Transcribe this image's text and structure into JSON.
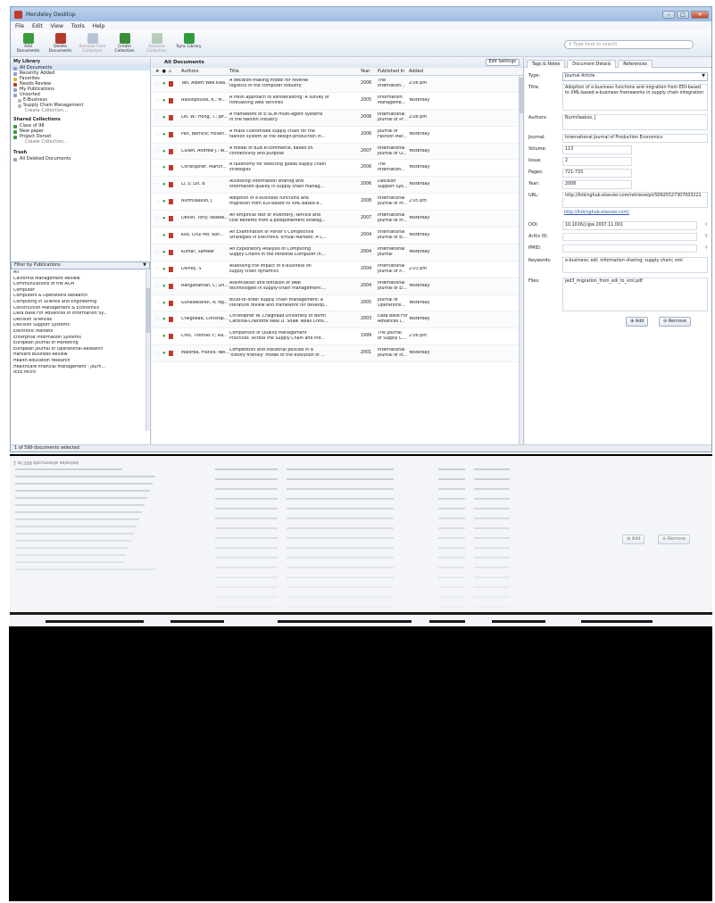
{
  "window": {
    "title": "Mendeley Desktop",
    "controls": [
      "–",
      "□",
      "✕"
    ]
  },
  "menu": [
    "File",
    "Edit",
    "View",
    "Tools",
    "Help"
  ],
  "toolbar": {
    "buttons": [
      {
        "label": "Add Documents",
        "icon": "add-document-icon",
        "enabled": true,
        "color": "#3a9b3a"
      },
      {
        "label": "Delete Documents",
        "icon": "delete-document-icon",
        "enabled": true,
        "color": "#b43b2b"
      },
      {
        "label": "Remove from Collection",
        "icon": "remove-from-collection-icon",
        "enabled": false,
        "color": "#6d86a8"
      },
      {
        "label": "Create Collection",
        "icon": "create-collection-icon",
        "enabled": true,
        "color": "#3a8e3a"
      },
      {
        "label": "Remove Collection",
        "icon": "remove-collection-icon",
        "enabled": false,
        "color": "#6d9a6d"
      },
      {
        "label": "Sync Library",
        "icon": "sync-icon",
        "enabled": true,
        "color": "#2e9d3d"
      }
    ],
    "search_placeholder": "Type here to search"
  },
  "sidebar": {
    "my_library_heading": "My Library",
    "library_items": [
      {
        "label": "All Documents",
        "selected": true,
        "color": "#8aa3c4"
      },
      {
        "label": "Recently Added",
        "selected": false,
        "color": "#8aa3c4"
      },
      {
        "label": "Favorites",
        "selected": false,
        "color": "#e2b23a"
      },
      {
        "label": "Needs Review",
        "selected": false,
        "color": "#c0392b"
      },
      {
        "label": "My Publications",
        "selected": false,
        "color": "#8aa3c4"
      },
      {
        "label": "Unsorted",
        "selected": false,
        "color": "#8aa3c4"
      },
      {
        "label": "E-Business",
        "selected": false,
        "color": "#b0b8c4"
      },
      {
        "label": "Supply Chain Management",
        "selected": false,
        "color": "#b0b8c4"
      }
    ],
    "create_collection": "Create Collection...",
    "shared_heading": "Shared Collections",
    "shared_items": [
      {
        "label": "Class of 98",
        "color": "#3a9b3a"
      },
      {
        "label": "New paper",
        "color": "#3a9b3a"
      },
      {
        "label": "Project Dorset",
        "color": "#3a9b3a"
      }
    ],
    "shared_create": "Create Collection...",
    "trash_heading": "Trash",
    "trash_item": "All Deleted Documents",
    "filter_label": "Filter by Publications",
    "filter_first": "All",
    "filter_items": [
      "California Management Review",
      "Communications of the ACM",
      "Computer",
      "Computers & Operations Research",
      "Computing in Science and Engineering",
      "Construction Management & Economics",
      "Data Base For Advances In Information Sy...",
      "Decision Sciences",
      "Decision Support Systems",
      "Electronic Markets",
      "Enterprise Information Systems",
      "European Journal of Marketing",
      "European Journal of Operational Research",
      "Harvard Business Review",
      "Health education research",
      "Healthcare financial management : journ...",
      "IEEE Micro"
    ]
  },
  "center": {
    "heading": "All Documents",
    "edit_settings": "Edit Settings",
    "columns": {
      "authors": "Authors",
      "title": "Title",
      "year": "Year",
      "published_in": "Published In",
      "added": "Added"
    },
    "rows": [
      {
        "authors": "Tan, Albert Wee Kwa...",
        "title": [
          "A decision-making model for reverse",
          "logistics in the computer industry"
        ],
        "year": "2006",
        "pub": [
          "The",
          "Internation..."
        ],
        "added": "2:06 pm"
      },
      {
        "authors": "Nikolopoulos, K.; M...",
        "title": [
          "A fresh approach to eshowcasting: A survey of",
          "forecasting Web services"
        ],
        "year": "2005",
        "pub": [
          "Information",
          "Manageme..."
        ],
        "added": "Yesterday"
      },
      {
        "authors": "Lin, W.; Hong, T.; Jer...",
        "title": [
          "A framework of E-SCM multi-agent systems",
          "in the fashion industry"
        ],
        "year": "2008",
        "pub": [
          "International",
          "Journal of Pr..."
        ],
        "added": "2:08 pm"
      },
      {
        "authors": "Pan, Bernice; Holleri...",
        "title": [
          "A mass customised supply chain for the",
          "fashion system at the design-production in..."
        ],
        "year": "2006",
        "pub": [
          "Journal of",
          "Fashion Mar..."
        ],
        "added": "Yesterday"
      },
      {
        "authors": "Cullen, Andrew J.; W...",
        "title": [
          "A model of B2B e-commerce, based on",
          "connectivity and purpose"
        ],
        "year": "2007",
        "pub": [
          "International",
          "Journal of O..."
        ],
        "added": "Yesterday"
      },
      {
        "authors": "Christopher, Martin...",
        "title": [
          "A taxonomy for selecting global supply chain",
          "strategies"
        ],
        "year": "2006",
        "pub": [
          "The",
          "Internation..."
        ],
        "added": "Yesterday"
      },
      {
        "authors": "Li, S; Lin, B",
        "title": [
          "Accessing information sharing and",
          "information quality in supply chain manag..."
        ],
        "year": "2006",
        "pub": [
          "Decision",
          "Support Sys..."
        ],
        "added": "Yesterday"
      },
      {
        "authors": "Nurmilaakso, J",
        "title": [
          "Adoption of e-business functions and",
          "migration from EDI-based to XML-based e..."
        ],
        "year": "2008",
        "pub": [
          "International",
          "Journal of Pr..."
        ],
        "added": "2:05 pm"
      },
      {
        "authors": "Devlin, Tony; Nowak...",
        "title": [
          "An empirical test of inventory, service and",
          "cost benefits from a postponement strateg..."
        ],
        "year": "2007",
        "pub": [
          "International",
          "Journal of Pr..."
        ],
        "added": "Yesterday"
      },
      {
        "authors": "Koo, Chul Mo; Koh...",
        "title": [
          "An Examination of Porter's Competitive",
          "Strategies in Electronic Virtual Markets: A C..."
        ],
        "year": "2004",
        "pub": [
          "International",
          "Journal of El..."
        ],
        "added": "Yesterday"
      },
      {
        "authors": "Kumar, Sameer",
        "title": [
          "An Exploratory Analysis of Computing",
          "Supply Chains in the Personal Computer In..."
        ],
        "year": "2004",
        "pub": [
          "International",
          "Journal"
        ],
        "added": "Yesterday"
      },
      {
        "authors": "Disney, S",
        "title": [
          "Assessing the impact of e-business on",
          "supply chain dynamics"
        ],
        "year": "2004",
        "pub": [
          "International",
          "Journal of P..."
        ],
        "added": "2:03 pm"
      },
      {
        "authors": "Ranganathan, C; Dh...",
        "title": [
          "Assimilation and diffusion of Web",
          "technologies in supply-chain management:..."
        ],
        "year": "2004",
        "pub": [
          "International",
          "Journal of El..."
        ],
        "added": "Yesterday"
      },
      {
        "authors": "Gunasekaran, A; Ng...",
        "title": [
          "Build-to-order supply chain management: a",
          "literature review and framework for develop..."
        ],
        "year": "2005",
        "pub": [
          "Journal of",
          "Operations..."
        ],
        "added": "Yesterday"
      },
      {
        "authors": "Craighead, Christop...",
        "title": [
          "Christopher W. Craighead University of North",
          "Carolina-Charlotte Neal D. Shaw Texas Chris..."
        ],
        "year": "2003",
        "pub": [
          "Data Base For",
          "Advances I..."
        ],
        "added": "Yesterday"
      },
      {
        "authors": "Choi, Thomas Y.; Ra...",
        "title": [
          "Comparison of Quality Management",
          "Practices: Across the Supply Chain and Ind..."
        ],
        "year": "1999",
        "pub": [
          "The Journal",
          "of Supply C..."
        ],
        "added": "2:06 pm"
      },
      {
        "authors": "Malerba, Franco; Nel...",
        "title": [
          "Competition and industrial policies in a",
          "'history friendly' model of the evolution of ..."
        ],
        "year": "2001",
        "pub": [
          "International",
          "Journal of In..."
        ],
        "added": "Yesterday"
      }
    ]
  },
  "details": {
    "tabs": [
      "Tags & Notes",
      "Document Details",
      "References"
    ],
    "active_tab": 1,
    "labels": {
      "type": "Type:",
      "title": "Title:",
      "authors": "Authors:",
      "journal": "Journal:",
      "volume": "Volume:",
      "issue": "Issue:",
      "pages": "Pages:",
      "year": "Year:",
      "url": "URL:",
      "doi": "DOI:",
      "arxiv": "ArXiv ID:",
      "pmid": "PMID:",
      "keywords": "Keywords:",
      "files": "Files:"
    },
    "values": {
      "type": "Journal Article",
      "title": "Adoption of e-business functions and migration from EDI-based to XML-based e-business frameworks in supply chain integration",
      "authors": "Nurmilaakso, J",
      "journal": "International Journal of Production Economics",
      "volume": "113",
      "issue": "2",
      "pages": "721-733",
      "year": "2008",
      "url": "http://linkinghub.elsevier.com/retrieve/pii/S0925527307003221",
      "url_link": "http://linkinghub.elsevier.com/",
      "doi": "10.1016/j.ijpe.2007.11.001",
      "arxiv": "",
      "pmid": "",
      "keywords": "e-business; edi; information sharing; supply chain; xml",
      "files": "jed3_migration_from_edi_to_xml.pdf"
    },
    "add_button": "Add",
    "remove_button": "Remove"
  },
  "status": "1 of 599 documents selected",
  "reflection_status": "1 of 599 documents selected"
}
